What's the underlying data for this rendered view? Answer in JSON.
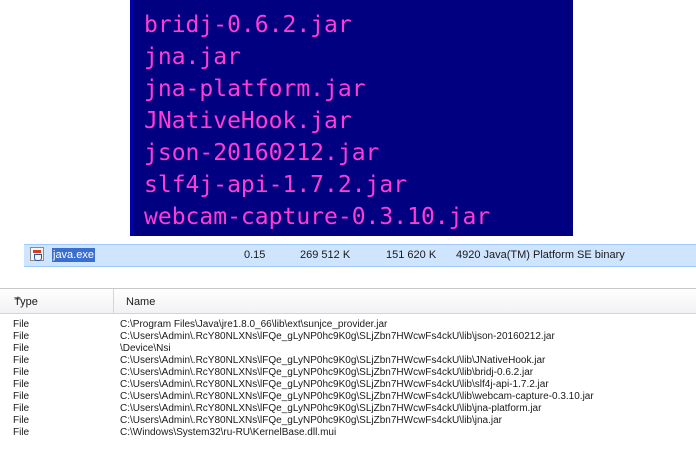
{
  "console": {
    "lines": [
      "bridj-0.6.2.jar",
      "jna.jar",
      "jna-platform.jar",
      "JNativeHook.jar",
      "json-20160212.jar",
      "slf4j-api-1.7.2.jar",
      "webcam-capture-0.3.10.jar"
    ]
  },
  "process": {
    "name": "java.exe",
    "cpu": "0.15",
    "private_bytes": "269 512 K",
    "working_set": "151 620 K",
    "pid_description": "4920 Java(TM) Platform SE binary"
  },
  "handles": {
    "columns": {
      "type": "Type",
      "name": "Name"
    },
    "rows": [
      {
        "type": "File",
        "name": "C:\\Program Files\\Java\\jre1.8.0_66\\lib\\ext\\sunjce_provider.jar"
      },
      {
        "type": "File",
        "name": "C:\\Users\\Admin\\.RcY80NLXNs\\lFQe_gLyNP0hc9K0g\\SLjZbn7HWcwFs4ckU\\lib\\json-20160212.jar"
      },
      {
        "type": "File",
        "name": "\\Device\\Nsi"
      },
      {
        "type": "File",
        "name": "C:\\Users\\Admin\\.RcY80NLXNs\\lFQe_gLyNP0hc9K0g\\SLjZbn7HWcwFs4ckU\\lib\\JNativeHook.jar"
      },
      {
        "type": "File",
        "name": "C:\\Users\\Admin\\.RcY80NLXNs\\lFQe_gLyNP0hc9K0g\\SLjZbn7HWcwFs4ckU\\lib\\bridj-0.6.2.jar"
      },
      {
        "type": "File",
        "name": "C:\\Users\\Admin\\.RcY80NLXNs\\lFQe_gLyNP0hc9K0g\\SLjZbn7HWcwFs4ckU\\lib\\slf4j-api-1.7.2.jar"
      },
      {
        "type": "File",
        "name": "C:\\Users\\Admin\\.RcY80NLXNs\\lFQe_gLyNP0hc9K0g\\SLjZbn7HWcwFs4ckU\\lib\\webcam-capture-0.3.10.jar"
      },
      {
        "type": "File",
        "name": "C:\\Users\\Admin\\.RcY80NLXNs\\lFQe_gLyNP0hc9K0g\\SLjZbn7HWcwFs4ckU\\lib\\jna-platform.jar"
      },
      {
        "type": "File",
        "name": "C:\\Users\\Admin\\.RcY80NLXNs\\lFQe_gLyNP0hc9K0g\\SLjZbn7HWcwFs4ckU\\lib\\jna.jar"
      },
      {
        "type": "File",
        "name": "C:\\Windows\\System32\\ru-RU\\KernelBase.dll.mui"
      }
    ]
  },
  "colors": {
    "console_bg": "#000080",
    "console_text": "#ff3cd3",
    "selection": "#cfe4ff"
  }
}
